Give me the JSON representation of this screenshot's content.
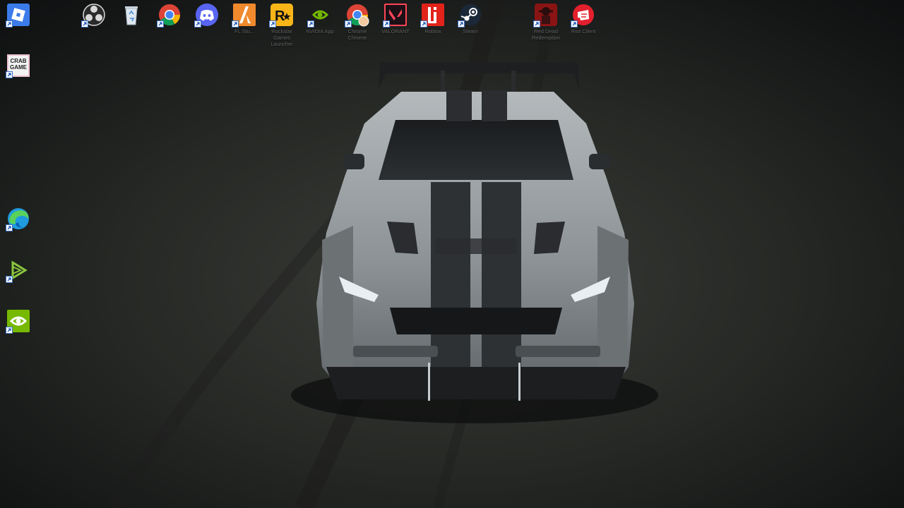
{
  "desktop": {
    "wallpaper": {
      "subject": "grey-muscle-car-top-view",
      "colors": {
        "ground": "#2b2d2b",
        "car_body": "#9aa0a3",
        "stripe": "#2a2c2e"
      }
    },
    "icons_top_row": [
      {
        "id": "roblox",
        "label": "",
        "icon": "roblox-icon",
        "color": "#3b7bea"
      },
      {
        "id": "obs",
        "label": "",
        "icon": "obs-icon",
        "color": "#2a2a2a"
      },
      {
        "id": "recycle-bin",
        "label": "",
        "icon": "recycle-bin-icon",
        "color": "#dfe6ee"
      },
      {
        "id": "chrome",
        "label": "",
        "icon": "chrome-icon",
        "color": "#4285f4"
      },
      {
        "id": "discord",
        "label": "",
        "icon": "discord-icon",
        "color": "#5865f2"
      },
      {
        "id": "fl-studio",
        "label": "FL Stu...",
        "icon": "fl-studio-icon",
        "color": "#f08a2c"
      },
      {
        "id": "rockstar",
        "label": "Rockstar Games Launcher",
        "icon": "rockstar-icon",
        "color": "#f7b518"
      },
      {
        "id": "nvidia-app",
        "label": "NVIDIA App",
        "icon": "nvidia-icon",
        "color": "#76b900"
      },
      {
        "id": "chrome-profile",
        "label": "Chrome Chrome",
        "icon": "chrome-profile-icon",
        "color": "#4285f4"
      },
      {
        "id": "valorant",
        "label": "VALORANT",
        "icon": "valorant-icon",
        "color": "#fd4556"
      },
      {
        "id": "roblox-studio",
        "label": "Roblox",
        "icon": "roblox-studio-icon",
        "color": "#e2231a"
      },
      {
        "id": "steam",
        "label": "Steam",
        "icon": "steam-icon",
        "color": "#1b2838"
      },
      {
        "id": "red-dead",
        "label": "Red Dead Redemption",
        "icon": "red-dead-icon",
        "color": "#8a1414"
      },
      {
        "id": "riot-client",
        "label": "Riot Client",
        "icon": "riot-client-icon",
        "color": "#e3202d"
      }
    ],
    "icons_left_column": [
      {
        "id": "crab-game",
        "label": "",
        "icon": "crab-game-icon",
        "color": "#f3f3f3",
        "text": "CRAB GAME"
      },
      {
        "id": "edge",
        "label": "",
        "icon": "edge-icon",
        "color": "#1f9bde"
      },
      {
        "id": "capcut",
        "label": "",
        "icon": "capcut-icon",
        "color": "#8ac53f"
      },
      {
        "id": "geforce",
        "label": "",
        "icon": "geforce-experience-icon",
        "color": "#76b900"
      }
    ]
  }
}
